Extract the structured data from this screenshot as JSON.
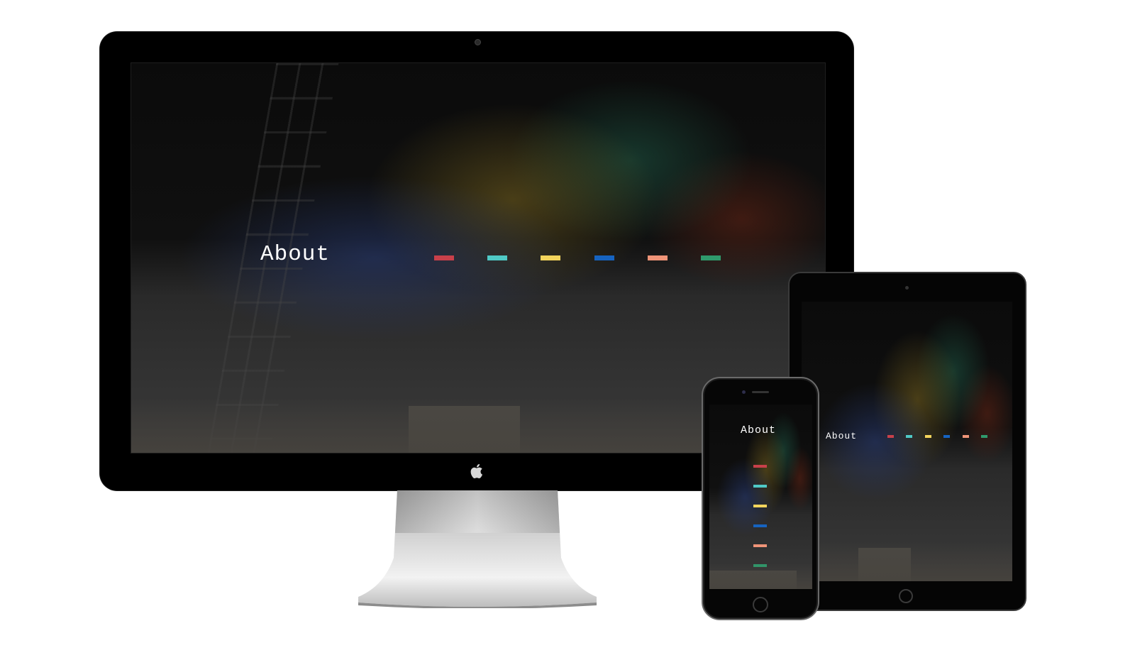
{
  "heading": "About",
  "flags": [
    {
      "name": "red",
      "color": "#c8404a"
    },
    {
      "name": "teal",
      "color": "#4fc9c6"
    },
    {
      "name": "yellow",
      "color": "#f3d45c"
    },
    {
      "name": "blue",
      "color": "#1663c0"
    },
    {
      "name": "salmon",
      "color": "#ef9478"
    },
    {
      "name": "green",
      "color": "#2f9a6c"
    }
  ],
  "devices": {
    "desktop": {
      "heading": "About",
      "icon": "apple-logo-icon"
    },
    "tablet": {
      "heading": "About"
    },
    "phone": {
      "heading": "About"
    }
  }
}
